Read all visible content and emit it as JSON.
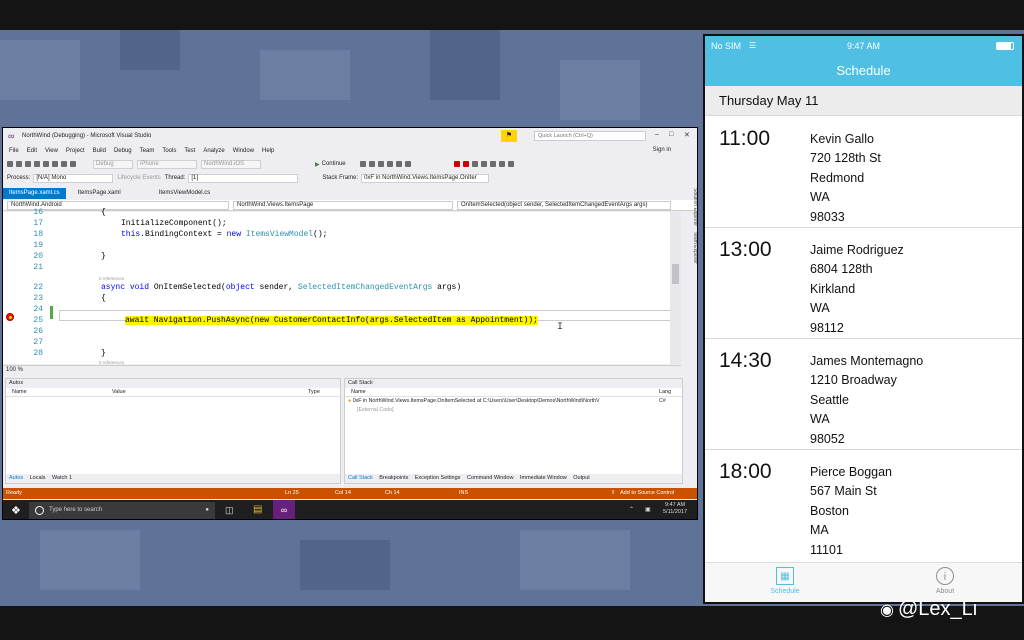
{
  "vs": {
    "window_title": "NorthWind (Debugging) - Microsoft Visual Studio",
    "quick_launch_placeholder": "Quick Launch (Ctrl+Q)",
    "sign_in": "Sign in",
    "menu": [
      "File",
      "Edit",
      "View",
      "Project",
      "Build",
      "Debug",
      "Team",
      "Tools",
      "Test",
      "Analyze",
      "Window",
      "Help"
    ],
    "toolbar": {
      "config": "Debug",
      "device": "iPhone",
      "project": "NorthWind.iOS",
      "continue": "Continue"
    },
    "process_label": "Process:",
    "process_value": "[N/A] Mono",
    "lifecycle": "Lifecycle Events",
    "thread_label": "Thread:",
    "thread_value": "[1]",
    "stack_frame_label": "Stack Frame:",
    "stack_frame_value": "0xF in NorthWind.Views.ItemsPage.OnIter",
    "tabs": [
      "ItemsPage.xaml.cs",
      "ItemsPage.xaml",
      "ItemsViewModel.cs"
    ],
    "nav": {
      "project": "NorthWind.Android",
      "class": "NorthWind.Views.ItemsPage",
      "member": "OnItemSelected(object sender, SelectedItemChangedEventArgs args)"
    },
    "line_numbers": [
      "16",
      "17",
      "18",
      "19",
      "20",
      "21",
      "22",
      "23",
      "24",
      "25",
      "26",
      "27",
      "28"
    ],
    "code": {
      "l16": "{",
      "l17": "InitializeComponent();",
      "l18a": "this",
      "l18b": ".BindingContext = ",
      "l18c": "new",
      "l18d": "ItemsViewModel",
      "l18e": "();",
      "l20": "}",
      "refs": "0 references",
      "l22a": "async",
      "l22b": "void",
      "l22c": "OnItemSelected(",
      "l22d": "object",
      "l22e": " sender, ",
      "l22f": "SelectedItemChangedEventArgs",
      "l22g": " args)",
      "l23": "{",
      "l25": "await Navigation.PushAsync(new CustomerContactInfo(args.SelectedItem as Appointment));",
      "l28": "}",
      "refs2": "0 references"
    },
    "zoom": "100 %",
    "autos": {
      "title": "Autos",
      "cols": [
        "Name",
        "Value",
        "Type"
      ],
      "tabs": [
        "Autos",
        "Locals",
        "Watch 1"
      ]
    },
    "callstack": {
      "title": "Call Stack",
      "cols": [
        "Name",
        "Lang"
      ],
      "rows": [
        "0xF in NorthWind.Views.ItemsPage.OnItemSelected at C:\\Users\\User\\Desktop\\Demos\\NorthWind\\NorthV",
        "[External Code]"
      ],
      "lang": "C#",
      "tabs": [
        "Call Stack",
        "Breakpoints",
        "Exception Settings",
        "Command Window",
        "Immediate Window",
        "Output"
      ]
    },
    "status": {
      "ready": "Ready",
      "ln": "Ln 25",
      "col": "Col 14",
      "ch": "Ch 14",
      "ins": "INS",
      "source": "Add to Source Control"
    }
  },
  "taskbar": {
    "search_placeholder": "Type here to search",
    "time": "9:47 AM",
    "date": "5/11/2017"
  },
  "phone": {
    "carrier": "No SIM",
    "time": "9:47 AM",
    "nav_title": "Schedule",
    "date_header": "Thursday May 11",
    "entries": [
      {
        "time": "11:00",
        "name": "Kevin Gallo",
        "street": "720 128th St",
        "city": "Redmond",
        "state": "WA",
        "zip": "98033"
      },
      {
        "time": "13:00",
        "name": "Jaime Rodriguez",
        "street": "6804 128th",
        "city": "Kirkland",
        "state": "WA",
        "zip": "98112"
      },
      {
        "time": "14:30",
        "name": "James Montemagno",
        "street": "1210 Broadway",
        "city": "Seattle",
        "state": "WA",
        "zip": "98052"
      },
      {
        "time": "18:00",
        "name": "Pierce Boggan",
        "street": "567 Main St",
        "city": "Boston",
        "state": "MA",
        "zip": "11101"
      }
    ],
    "tabbar": [
      "Schedule",
      "About"
    ],
    "accent_color": "#4fbfe4"
  },
  "watermark": "@Lex_Li",
  "colors": {
    "vs_accent": "#007acc",
    "vs_status": "#ca5100",
    "desktop": "#5f7398"
  }
}
